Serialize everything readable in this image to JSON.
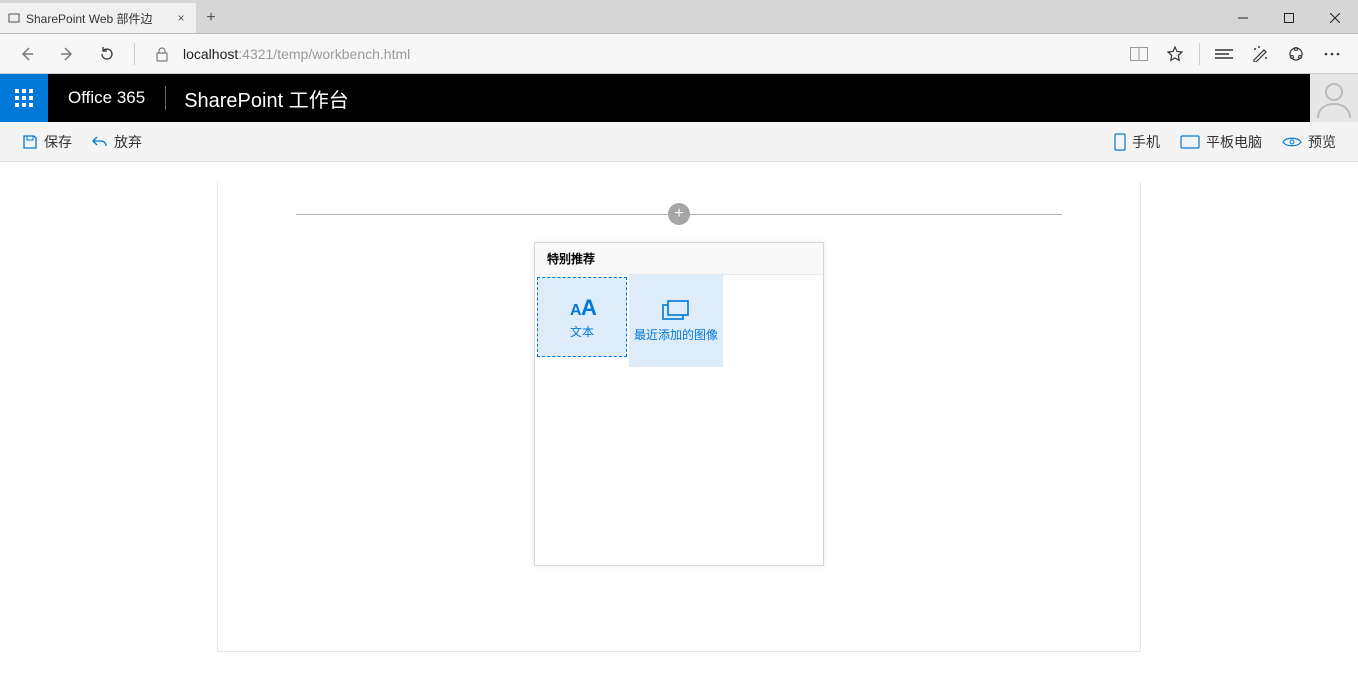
{
  "browser": {
    "tab_title": "SharePoint Web 部件边",
    "url_host": "localhost",
    "url_rest": ":4321/temp/workbench.html"
  },
  "suite": {
    "o365": "Office 365",
    "workbench": "SharePoint 工作台"
  },
  "commands": {
    "save": "保存",
    "discard": "放弃",
    "mobile": "手机",
    "tablet": "平板电脑",
    "preview": "预览"
  },
  "picker": {
    "header": "特别推荐",
    "tiles": [
      {
        "label": "文本"
      },
      {
        "label": "最近添加的图像"
      }
    ]
  }
}
